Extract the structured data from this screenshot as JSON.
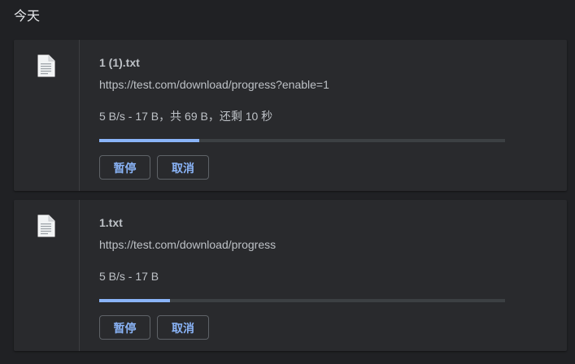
{
  "section": {
    "title": "今天"
  },
  "downloads": [
    {
      "file_name": "1 (1).txt",
      "url": "https://test.com/download/progress?enable=1",
      "status": "5 B/s - 17 B，共 69 B，还剩 10 秒",
      "progress": 0.246,
      "pause_label": "暂停",
      "cancel_label": "取消",
      "icon": "file-icon"
    },
    {
      "file_name": "1.txt",
      "url": "https://test.com/download/progress",
      "status": "5 B/s - 17 B",
      "progress": 0.175,
      "pause_label": "暂停",
      "cancel_label": "取消",
      "icon": "file-icon"
    }
  ],
  "colors": {
    "background": "#202124",
    "card": "#292a2d",
    "accent": "#8ab4f8",
    "text": "#bdc1c6"
  }
}
